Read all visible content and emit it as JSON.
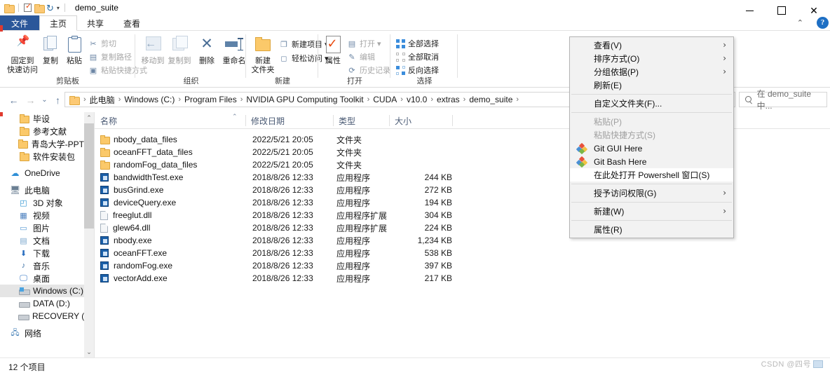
{
  "window": {
    "title": "demo_suite",
    "quick_access": [
      {
        "name": "folder-icon",
        "label": ""
      },
      {
        "name": "properties-check-icon",
        "label": ""
      },
      {
        "name": "new-folder-icon",
        "label": ""
      },
      {
        "name": "redo-icon",
        "label": ""
      },
      {
        "name": "chevron-down-icon",
        "label": "▾"
      }
    ],
    "controls": {
      "minimize": "—",
      "maximize": "□",
      "close": "✕"
    },
    "help_label": "?",
    "ribbon_collapse": "⌃"
  },
  "tabs": [
    {
      "id": "file",
      "label": "文件"
    },
    {
      "id": "home",
      "label": "主页"
    },
    {
      "id": "share",
      "label": "共享"
    },
    {
      "id": "view",
      "label": "查看"
    }
  ],
  "ribbon": {
    "groups": [
      {
        "name": "剪贴板",
        "big": [
          {
            "label_l1": "固定到",
            "label_l2": "快速访问",
            "icon": "pin-icon"
          },
          {
            "label_l1": "复制",
            "label_l2": "",
            "icon": "copy-icon"
          },
          {
            "label_l1": "粘贴",
            "label_l2": "",
            "icon": "paste-icon"
          }
        ],
        "small": [
          {
            "label": "剪切",
            "icon": "scissors-icon",
            "disabled": true
          },
          {
            "label": "复制路径",
            "icon": "copy-path-icon",
            "disabled": true
          },
          {
            "label": "粘贴快捷方式",
            "icon": "paste-shortcut-icon",
            "disabled": true
          }
        ]
      },
      {
        "name": "组织",
        "big": [
          {
            "label_l1": "移动到",
            "label_l2": "",
            "icon": "move-to-icon",
            "dim": true
          },
          {
            "label_l1": "复制到",
            "label_l2": "",
            "icon": "copy-to-icon",
            "dim": true
          },
          {
            "label_l1": "删除",
            "label_l2": "",
            "icon": "delete-icon"
          },
          {
            "label_l1": "重命名",
            "label_l2": "",
            "icon": "rename-icon"
          }
        ],
        "small": []
      },
      {
        "name": "新建",
        "big": [
          {
            "label_l1": "新建",
            "label_l2": "文件夹",
            "icon": "new-folder-icon"
          }
        ],
        "small": [
          {
            "label": "新建项目 ▾",
            "icon": "new-item-icon",
            "disabled": false
          },
          {
            "label": "轻松访问 ▾",
            "icon": "easy-access-icon",
            "disabled": false
          }
        ]
      },
      {
        "name": "打开",
        "big": [
          {
            "label_l1": "属性",
            "label_l2": "",
            "icon": "properties-icon"
          }
        ],
        "small": [
          {
            "label": "打开 ▾",
            "icon": "open-icon",
            "disabled": true
          },
          {
            "label": "编辑",
            "icon": "edit-icon",
            "disabled": true
          },
          {
            "label": "历史记录",
            "icon": "history-icon",
            "disabled": true
          }
        ]
      },
      {
        "name": "选择",
        "big": [],
        "small": [
          {
            "label": "全部选择",
            "icon": "select-all-icon",
            "disabled": false
          },
          {
            "label": "全部取消",
            "icon": "select-none-icon",
            "disabled": false
          },
          {
            "label": "反向选择",
            "icon": "invert-selection-icon",
            "disabled": false
          }
        ]
      }
    ]
  },
  "addressbar": {
    "back": "←",
    "forward": "→",
    "recent": "⌄",
    "up": "↑",
    "breadcrumbs": [
      "此电脑",
      "Windows (C:)",
      "Program Files",
      "NVIDIA GPU Computing Toolkit",
      "CUDA",
      "v10.0",
      "extras",
      "demo_suite"
    ],
    "separator": "›",
    "search_placeholder": "在 demo_suite 中..."
  },
  "sidebar": {
    "items": [
      {
        "label": "毕设",
        "icon": "folder-icon",
        "indent": 1
      },
      {
        "label": "参考文献",
        "icon": "folder-icon",
        "indent": 1
      },
      {
        "label": "青岛大学-PPT",
        "icon": "folder-icon",
        "indent": 1
      },
      {
        "label": "软件安装包",
        "icon": "folder-icon",
        "indent": 1
      },
      {
        "label": "OneDrive",
        "icon": "cloud-icon",
        "indent": 0
      },
      {
        "label": "此电脑",
        "icon": "this-pc-icon",
        "indent": 0
      },
      {
        "label": "3D 对象",
        "icon": "3d-objects-icon",
        "indent": 1
      },
      {
        "label": "视频",
        "icon": "videos-icon",
        "indent": 1
      },
      {
        "label": "图片",
        "icon": "pictures-icon",
        "indent": 1
      },
      {
        "label": "文档",
        "icon": "documents-icon",
        "indent": 1
      },
      {
        "label": "下载",
        "icon": "downloads-icon",
        "indent": 1
      },
      {
        "label": "音乐",
        "icon": "music-icon",
        "indent": 1
      },
      {
        "label": "桌面",
        "icon": "desktop-icon",
        "indent": 1
      },
      {
        "label": "Windows (C:)",
        "icon": "drive-windows-icon",
        "indent": 1,
        "selected": true
      },
      {
        "label": "DATA (D:)",
        "icon": "drive-icon",
        "indent": 1
      },
      {
        "label": "RECOVERY (E:)",
        "icon": "drive-icon",
        "indent": 1
      },
      {
        "label": "网络",
        "icon": "network-icon",
        "indent": 0
      }
    ],
    "scroll_up": "⌃",
    "scroll_down": "⌄"
  },
  "filelist": {
    "columns": [
      {
        "key": "name",
        "label": "名称",
        "sorted": true,
        "sort_caret": "⌃"
      },
      {
        "key": "date",
        "label": "修改日期"
      },
      {
        "key": "type",
        "label": "类型"
      },
      {
        "key": "size",
        "label": "大小"
      }
    ],
    "rows": [
      {
        "name": "nbody_data_files",
        "date": "2022/5/21 20:05",
        "type": "文件夹",
        "size": "",
        "icon": "folder-icon"
      },
      {
        "name": "oceanFFT_data_files",
        "date": "2022/5/21 20:05",
        "type": "文件夹",
        "size": "",
        "icon": "folder-icon"
      },
      {
        "name": "randomFog_data_files",
        "date": "2022/5/21 20:05",
        "type": "文件夹",
        "size": "",
        "icon": "folder-icon"
      },
      {
        "name": "bandwidthTest.exe",
        "date": "2018/8/26 12:33",
        "type": "应用程序",
        "size": "244 KB",
        "icon": "exe-icon"
      },
      {
        "name": "busGrind.exe",
        "date": "2018/8/26 12:33",
        "type": "应用程序",
        "size": "272 KB",
        "icon": "exe-icon"
      },
      {
        "name": "deviceQuery.exe",
        "date": "2018/8/26 12:33",
        "type": "应用程序",
        "size": "194 KB",
        "icon": "exe-icon"
      },
      {
        "name": "freeglut.dll",
        "date": "2018/8/26 12:33",
        "type": "应用程序扩展",
        "size": "304 KB",
        "icon": "dll-icon"
      },
      {
        "name": "glew64.dll",
        "date": "2018/8/26 12:33",
        "type": "应用程序扩展",
        "size": "224 KB",
        "icon": "dll-icon"
      },
      {
        "name": "nbody.exe",
        "date": "2018/8/26 12:33",
        "type": "应用程序",
        "size": "1,234 KB",
        "icon": "exe-icon"
      },
      {
        "name": "oceanFFT.exe",
        "date": "2018/8/26 12:33",
        "type": "应用程序",
        "size": "538 KB",
        "icon": "exe-icon"
      },
      {
        "name": "randomFog.exe",
        "date": "2018/8/26 12:33",
        "type": "应用程序",
        "size": "397 KB",
        "icon": "exe-icon"
      },
      {
        "name": "vectorAdd.exe",
        "date": "2018/8/26 12:33",
        "type": "应用程序",
        "size": "217 KB",
        "icon": "exe-icon"
      }
    ]
  },
  "statusbar": {
    "text": "12 个项目"
  },
  "contextmenu": {
    "items": [
      {
        "label": "查看(V)",
        "submenu": true,
        "disabled": false,
        "icon": null,
        "hover": false
      },
      {
        "label": "排序方式(O)",
        "submenu": true,
        "disabled": false,
        "icon": null,
        "hover": false
      },
      {
        "label": "分组依据(P)",
        "submenu": true,
        "disabled": false,
        "icon": null,
        "hover": false
      },
      {
        "label": "刷新(E)",
        "submenu": false,
        "disabled": false,
        "icon": null,
        "hover": false
      },
      {
        "separator": true
      },
      {
        "label": "自定义文件夹(F)...",
        "submenu": false,
        "disabled": false,
        "icon": null,
        "hover": false
      },
      {
        "separator": true
      },
      {
        "label": "粘贴(P)",
        "submenu": false,
        "disabled": true,
        "icon": null,
        "hover": false
      },
      {
        "label": "粘贴快捷方式(S)",
        "submenu": false,
        "disabled": true,
        "icon": null,
        "hover": false
      },
      {
        "label": "Git GUI Here",
        "submenu": false,
        "disabled": false,
        "icon": "git-icon",
        "hover": false
      },
      {
        "label": "Git Bash Here",
        "submenu": false,
        "disabled": false,
        "icon": "git-icon",
        "hover": false
      },
      {
        "label": "在此处打开 Powershell 窗口(S)",
        "submenu": false,
        "disabled": false,
        "icon": null,
        "hover": true
      },
      {
        "separator": true
      },
      {
        "label": "授予访问权限(G)",
        "submenu": true,
        "disabled": false,
        "icon": null,
        "hover": false
      },
      {
        "separator": true
      },
      {
        "label": "新建(W)",
        "submenu": true,
        "disabled": false,
        "icon": null,
        "hover": false
      },
      {
        "separator": true
      },
      {
        "label": "属性(R)",
        "submenu": false,
        "disabled": false,
        "icon": null,
        "hover": false
      }
    ],
    "arrow_glyph": "›"
  },
  "watermark": {
    "text": "CSDN @四号"
  },
  "colors": {
    "accent": "#2b579a",
    "folder": "#fbc96a",
    "selection": "#e5e5e5",
    "header_text": "#4a5a74"
  }
}
